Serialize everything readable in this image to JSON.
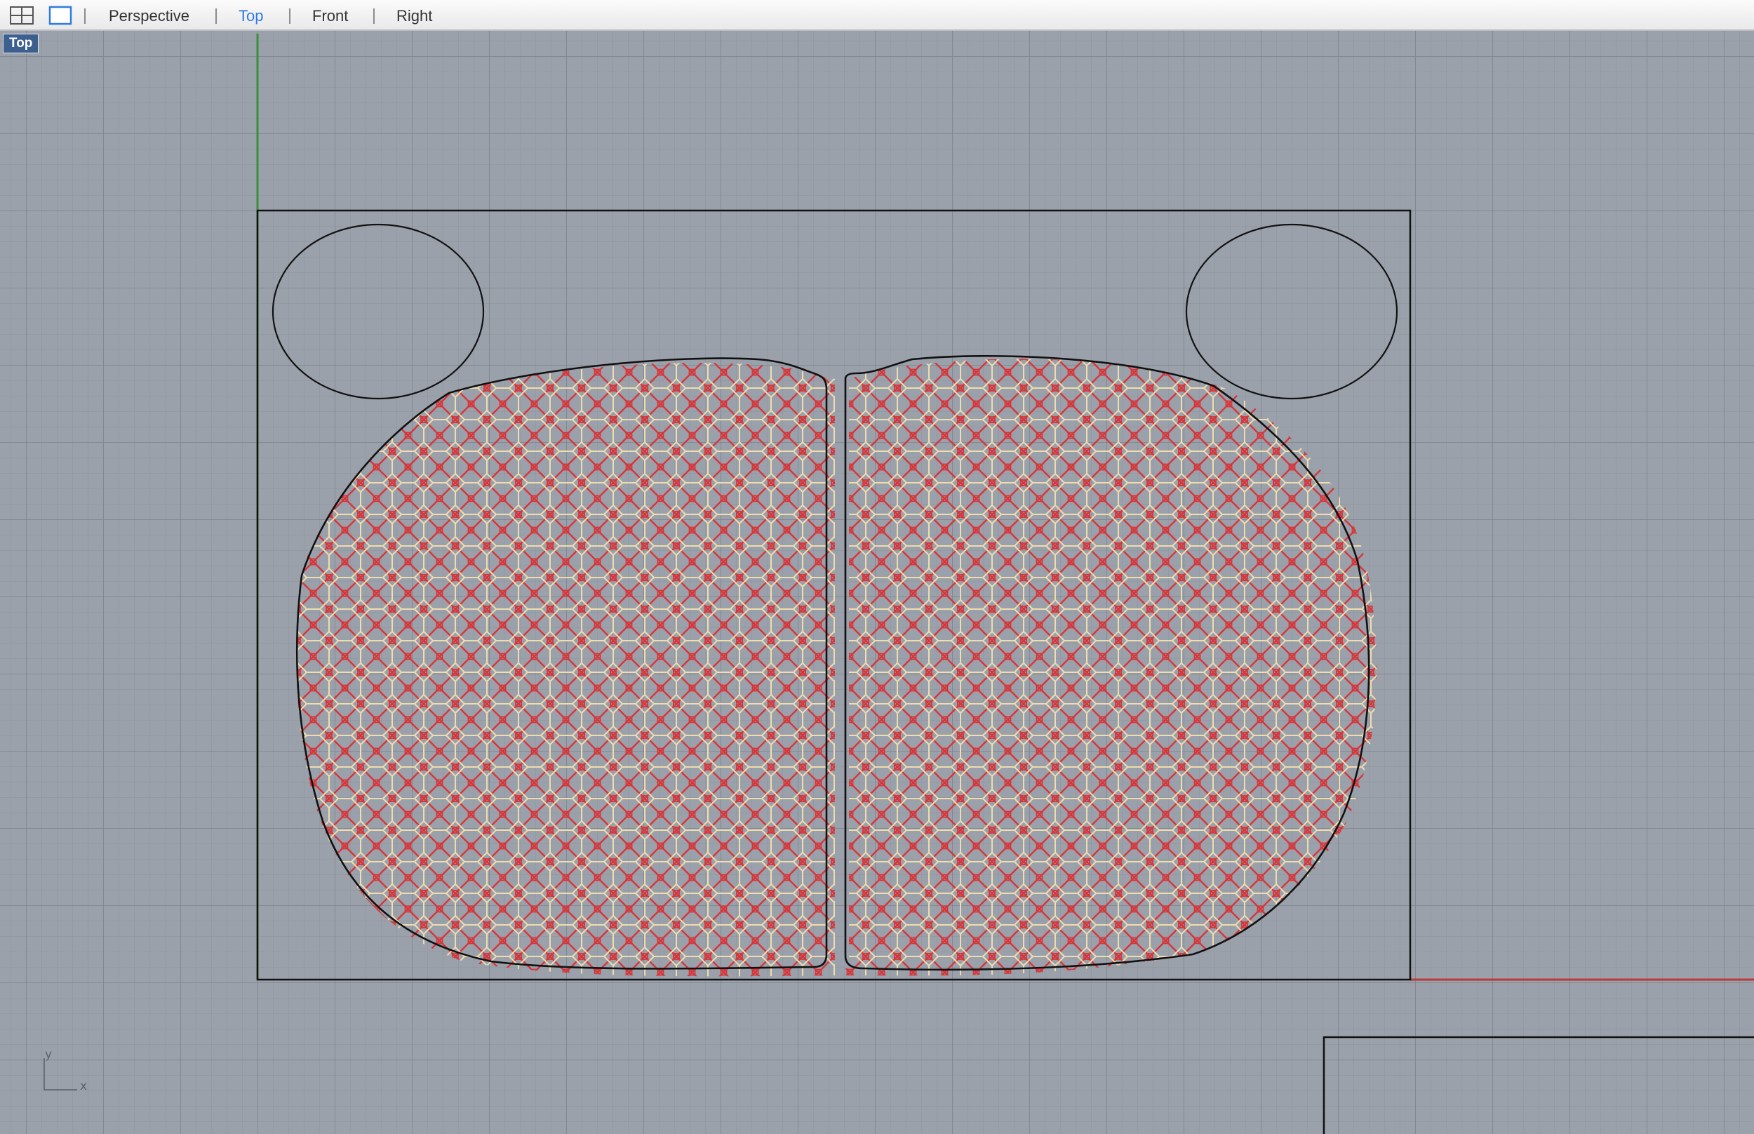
{
  "toolbar": {
    "layout_icon": "four-viewports-icon",
    "single_icon": "single-viewport-icon",
    "tabs": [
      {
        "label": "Perspective",
        "active": false
      },
      {
        "label": "Top",
        "active": true
      },
      {
        "label": "Front",
        "active": false
      },
      {
        "label": "Right",
        "active": false
      }
    ]
  },
  "viewport": {
    "label": "Top",
    "axis_y": "y",
    "axis_x": "x",
    "colors": {
      "background": "#9ba1ab",
      "grid_minor": "#8d939d",
      "grid_major": "#7b818b",
      "y_axis": "#3a8f3a",
      "x_axis": "#b83a3a",
      "curves": "#111111",
      "pattern_red": "#d6363a",
      "pattern_cream": "#f0dcae"
    }
  }
}
